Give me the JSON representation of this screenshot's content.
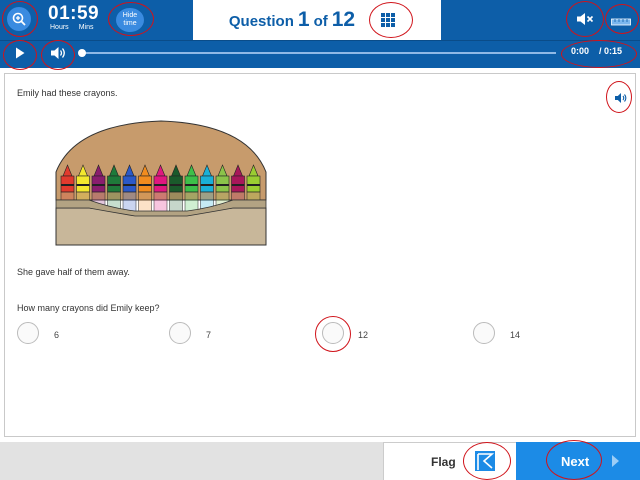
{
  "header": {
    "timer": {
      "time": "01:59",
      "hours_label": "Hours",
      "mins_label": "Mins"
    },
    "hide_time_line1": "Hide",
    "hide_time_line2": "time",
    "question_word": "Question",
    "question_number": "1",
    "of_word": "of",
    "question_total": "12"
  },
  "audio": {
    "current": "0:00",
    "duration": "/ 0:15"
  },
  "question": {
    "intro": "Emily had these crayons.",
    "followup": "She gave half of them away.",
    "prompt": "How many crayons did Emily keep?",
    "options": [
      "6",
      "7",
      "12",
      "14"
    ]
  },
  "footer": {
    "flag_label": "Flag",
    "next_label": "Next"
  },
  "icons": [
    "zoom-in-icon",
    "play-icon",
    "speaker-icon",
    "mute-icon",
    "grid-icon",
    "ruler-icon",
    "flag-icon",
    "chevron-right-icon"
  ],
  "colors": {
    "brand_blue": "#0d5ea8",
    "next_blue": "#1c8be6",
    "annotation_red": "#d0141b"
  }
}
